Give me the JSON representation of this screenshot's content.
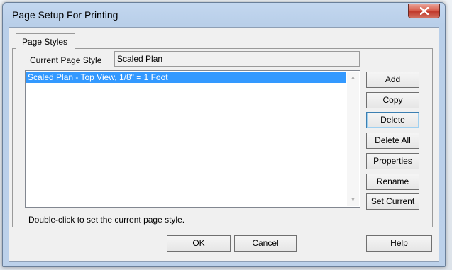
{
  "window": {
    "title": "Page Setup For Printing"
  },
  "tabs": [
    {
      "label": "Page Styles"
    }
  ],
  "current_page_style": {
    "label": "Current Page Style",
    "value": "Scaled Plan"
  },
  "style_list": {
    "items": [
      {
        "label": "Scaled Plan - Top View, 1/8\" = 1 Foot",
        "selected": true
      }
    ]
  },
  "side_buttons": {
    "add": "Add",
    "copy": "Copy",
    "delete": "Delete",
    "delete_all": "Delete All",
    "properties": "Properties",
    "rename": "Rename",
    "set_current": "Set Current"
  },
  "hint_text": "Double-click to set the current page style.",
  "footer_buttons": {
    "ok": "OK",
    "cancel": "Cancel",
    "help": "Help"
  },
  "colors": {
    "selection": "#3399ff",
    "close_button": "#c0392b",
    "title_bar": "#b9cfe9"
  },
  "icons": {
    "close": "close-x-icon",
    "scroll_up": "scroll-up-arrow-icon",
    "scroll_down": "scroll-down-arrow-icon"
  }
}
